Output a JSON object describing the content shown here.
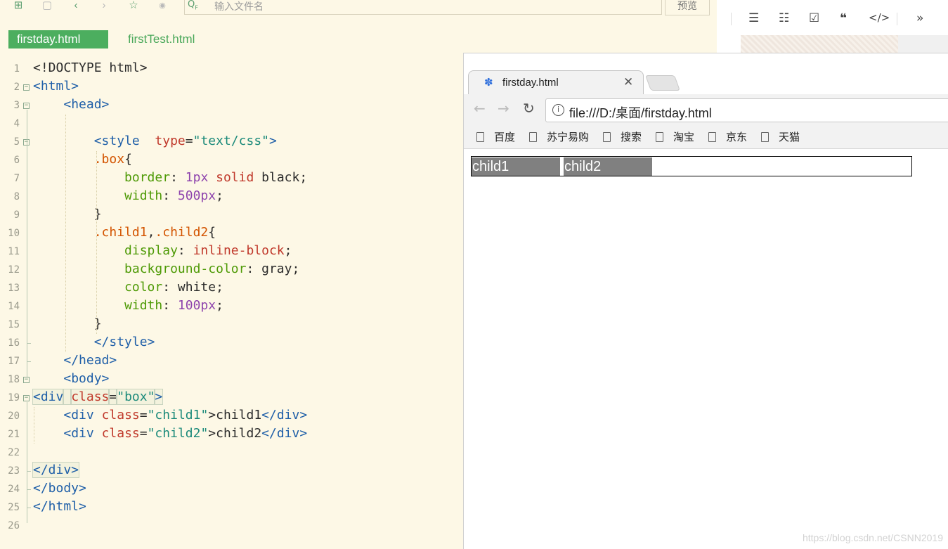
{
  "editor": {
    "search_placeholder": "输入文件名",
    "preview_label": "预览",
    "tabs": [
      "firstday.html",
      "firstTest.html"
    ],
    "lines": [
      [
        [
          "<!DOCTYPE html>",
          "text"
        ]
      ],
      [
        [
          "<html>",
          "tag"
        ]
      ],
      [
        [
          "    ",
          "text"
        ],
        [
          "<head>",
          "tag"
        ]
      ],
      [
        [
          "",
          "text"
        ]
      ],
      [
        [
          "        ",
          "text"
        ],
        [
          "<style",
          "tag"
        ],
        [
          "  ",
          "text"
        ],
        [
          "type",
          "attr"
        ],
        [
          "=",
          "text"
        ],
        [
          "\"text/css\"",
          "str"
        ],
        [
          ">",
          "tag"
        ]
      ],
      [
        [
          "        ",
          "text"
        ],
        [
          ".box",
          "sel"
        ],
        [
          "{",
          "text"
        ]
      ],
      [
        [
          "            ",
          "text"
        ],
        [
          "border",
          "prop"
        ],
        [
          ": ",
          "text"
        ],
        [
          "1px",
          "num"
        ],
        [
          " ",
          "text"
        ],
        [
          "solid",
          "val"
        ],
        [
          " black;",
          "text"
        ]
      ],
      [
        [
          "            ",
          "text"
        ],
        [
          "width",
          "prop"
        ],
        [
          ": ",
          "text"
        ],
        [
          "500px",
          "num"
        ],
        [
          ";",
          "text"
        ]
      ],
      [
        [
          "        }",
          "text"
        ]
      ],
      [
        [
          "        ",
          "text"
        ],
        [
          ".child1",
          "sel"
        ],
        [
          ",",
          "text"
        ],
        [
          ".child2",
          "sel"
        ],
        [
          "{",
          "text"
        ]
      ],
      [
        [
          "            ",
          "text"
        ],
        [
          "display",
          "prop"
        ],
        [
          ": ",
          "text"
        ],
        [
          "inline-block",
          "val"
        ],
        [
          ";",
          "text"
        ]
      ],
      [
        [
          "            ",
          "text"
        ],
        [
          "background-color",
          "prop"
        ],
        [
          ": gray;",
          "text"
        ]
      ],
      [
        [
          "            ",
          "text"
        ],
        [
          "color",
          "prop"
        ],
        [
          ": white;",
          "text"
        ]
      ],
      [
        [
          "            ",
          "text"
        ],
        [
          "width",
          "prop"
        ],
        [
          ": ",
          "text"
        ],
        [
          "100px",
          "num"
        ],
        [
          ";",
          "text"
        ]
      ],
      [
        [
          "        }",
          "text"
        ]
      ],
      [
        [
          "        ",
          "text"
        ],
        [
          "</style>",
          "tag"
        ]
      ],
      [
        [
          "    ",
          "text"
        ],
        [
          "</head>",
          "tag"
        ]
      ],
      [
        [
          "    ",
          "text"
        ],
        [
          "<body>",
          "tag"
        ]
      ],
      [
        [
          "<div",
          "tag"
        ],
        [
          " ",
          "text"
        ],
        [
          "class",
          "attr"
        ],
        [
          "=",
          "text"
        ],
        [
          "\"box\"",
          "str"
        ],
        [
          ">",
          "tag"
        ]
      ],
      [
        [
          "    ",
          "text"
        ],
        [
          "<div",
          "tag"
        ],
        [
          " ",
          "text"
        ],
        [
          "class",
          "attr"
        ],
        [
          "=",
          "text"
        ],
        [
          "\"child1\"",
          "str"
        ],
        [
          ">child1",
          "text"
        ],
        [
          "</div>",
          "tag"
        ]
      ],
      [
        [
          "    ",
          "text"
        ],
        [
          "<div",
          "tag"
        ],
        [
          " ",
          "text"
        ],
        [
          "class",
          "attr"
        ],
        [
          "=",
          "text"
        ],
        [
          "\"child2\"",
          "str"
        ],
        [
          ">child2",
          "text"
        ],
        [
          "</div>",
          "tag"
        ]
      ],
      [
        [
          "",
          "text"
        ]
      ],
      [
        [
          "</div>",
          "tag"
        ]
      ],
      [
        [
          "</body>",
          "tag"
        ]
      ],
      [
        [
          "</html>",
          "tag"
        ]
      ],
      [
        [
          "",
          "text"
        ]
      ]
    ]
  },
  "browser": {
    "tab_title": "firstday.html",
    "url": "file:///D:/桌面/firstday.html",
    "bookmarks": [
      "百度",
      "苏宁易购",
      "搜索",
      "淘宝",
      "京东",
      "天猫"
    ],
    "page": {
      "child1": "child1",
      "child2": "child2"
    }
  },
  "watermark": "https://blog.csdn.net/CSNN2019"
}
